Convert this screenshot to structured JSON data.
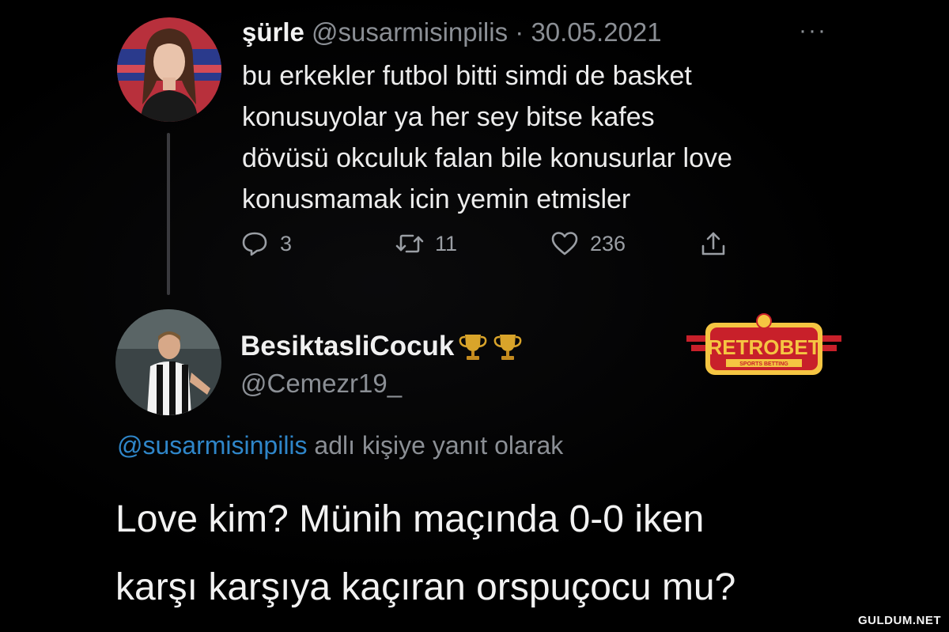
{
  "tweet1": {
    "name": "şürle",
    "handle": "@susarmisinpilis",
    "separator": "·",
    "date": "30.05.2021",
    "more": "···",
    "lines": [
      "bu erkekler futbol bitti simdi de basket",
      "konusuyolar ya her sey bitse kafes",
      "dövüsü okculuk falan bile konusurlar love",
      "konusmamak icin yemin etmisler"
    ],
    "actions": {
      "reply_count": "3",
      "retweet_count": "11",
      "like_count": "236"
    }
  },
  "tweet2": {
    "name": "BesiktasliCocuk",
    "handle": "@Cemezr19_",
    "reply_handle": "@susarmisinpilis",
    "reply_text": " adlı kişiye yanıt olarak",
    "lines": [
      "Love kim? Münih maçında 0-0 iken",
      "karşı karşıya kaçıran orspuçocu mu?"
    ]
  },
  "logo": {
    "brand": "RETROBET",
    "tagline": "SPORTS BETTING"
  },
  "watermark": "GULDUM.NET",
  "colors": {
    "background": "#000000",
    "mention": "#2f86c9",
    "secondary_text": "#8b8f95",
    "logo_red": "#c8202a",
    "logo_yellow": "#f5c542"
  },
  "icons": [
    "more-icon",
    "reply-icon",
    "retweet-icon",
    "like-icon",
    "share-icon",
    "trophy-icon"
  ]
}
